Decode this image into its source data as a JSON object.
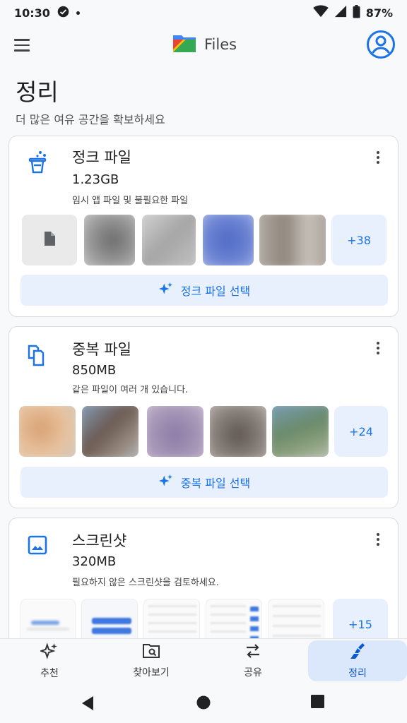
{
  "status_bar": {
    "time": "10:30",
    "battery": "87%"
  },
  "app_bar": {
    "title": "Files"
  },
  "page": {
    "title": "정리",
    "subtitle": "더 많은 여유 공간을 확보하세요"
  },
  "cards": [
    {
      "title": "정크 파일",
      "size": "1.23GB",
      "description": "임시 앱 파일 및 불필요한 파일",
      "more_count": "+38",
      "action": "정크 파일 선택",
      "icon": "junk-clean-icon"
    },
    {
      "title": "중복 파일",
      "size": "850MB",
      "description": "같은 파일이 여러 개 있습니다.",
      "more_count": "+24",
      "action": "중복 파일 선택",
      "icon": "duplicate-files-icon"
    },
    {
      "title": "스크린샷",
      "size": "320MB",
      "description": "필요하지 않은 스크린샷을 검토하세요.",
      "more_count": "+15",
      "icon": "image-icon"
    }
  ],
  "bottom_nav": [
    {
      "label": "추천",
      "icon": "sparkle-icon"
    },
    {
      "label": "찾아보기",
      "icon": "folder-search-icon"
    },
    {
      "label": "공유",
      "icon": "swap-arrows-icon"
    },
    {
      "label": "정리",
      "icon": "broom-icon",
      "active": true
    }
  ],
  "colors": {
    "accent": "#1a73e8",
    "accent_bg": "#e8f0fd",
    "active_nav_bg": "#dbe7fb"
  }
}
